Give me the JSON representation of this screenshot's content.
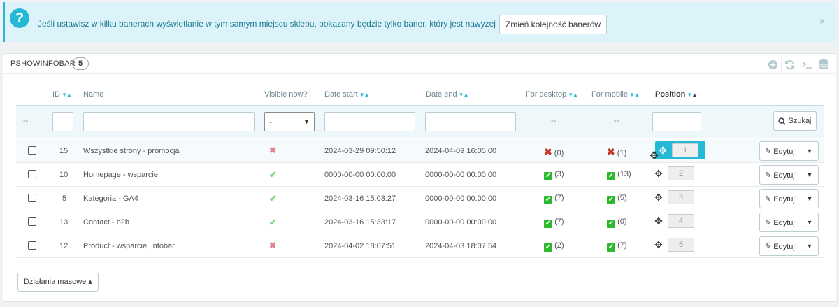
{
  "alert": {
    "icon": "question-icon",
    "text": "Jeśli ustawisz w kilku banerach wyświetlanie w tym samym miejscu sklepu, pokazany będzie tylko baner, który jest nawyżej na liście",
    "button": "Zmień kolejność banerów"
  },
  "panel": {
    "title": "PSHOWINFOBAR",
    "count": "5",
    "tools": [
      "add-icon",
      "refresh-icon",
      "terminal-icon",
      "database-icon"
    ]
  },
  "columns": {
    "id": "ID",
    "name": "Name",
    "visible": "Visible now?",
    "date_start": "Date start",
    "date_end": "Date end",
    "for_desktop": "For desktop",
    "for_mobile": "For mobile",
    "position": "Position"
  },
  "filters": {
    "bulk_placeholder": "--",
    "visible_selected": "-",
    "desktop_placeholder": "--",
    "mobile_placeholder": "--",
    "search_button": "Szukaj"
  },
  "rows": [
    {
      "id": "15",
      "name": "Wszystkie strony - promocja",
      "visible": false,
      "date_start": "2024-03-29 09:50:12",
      "date_end": "2024-04-09 16:05:00",
      "desktop": false,
      "desktop_count": "(0)",
      "mobile": false,
      "mobile_count": "(1)",
      "position": "1",
      "edit": "Edytuj"
    },
    {
      "id": "10",
      "name": "Homepage - wsparcie",
      "visible": true,
      "date_start": "0000-00-00 00:00:00",
      "date_end": "0000-00-00 00:00:00",
      "desktop": true,
      "desktop_count": "(3)",
      "mobile": true,
      "mobile_count": "(13)",
      "position": "2",
      "edit": "Edytuj"
    },
    {
      "id": "5",
      "name": "Kategoria - GA4",
      "visible": true,
      "date_start": "2024-03-16 15:03:27",
      "date_end": "0000-00-00 00:00:00",
      "desktop": true,
      "desktop_count": "(7)",
      "mobile": true,
      "mobile_count": "(5)",
      "position": "3",
      "edit": "Edytuj"
    },
    {
      "id": "13",
      "name": "Contact - b2b",
      "visible": true,
      "date_start": "2024-03-16 15:33:17",
      "date_end": "0000-00-00 00:00:00",
      "desktop": true,
      "desktop_count": "(7)",
      "mobile": true,
      "mobile_count": "(0)",
      "position": "4",
      "edit": "Edytuj"
    },
    {
      "id": "12",
      "name": "Product - wsparcie, infobar",
      "visible": false,
      "date_start": "2024-04-02 18:07:51",
      "date_end": "2024-04-03 18:07:54",
      "desktop": true,
      "desktop_count": "(2)",
      "mobile": true,
      "mobile_count": "(7)",
      "position": "5",
      "edit": "Edytuj"
    }
  ],
  "bulk_actions": "Działania masowe",
  "colors": {
    "accent": "#25b9d7",
    "alert_bg": "#dcf4f9",
    "success": "#2eb82e",
    "danger": "#c0392b"
  }
}
